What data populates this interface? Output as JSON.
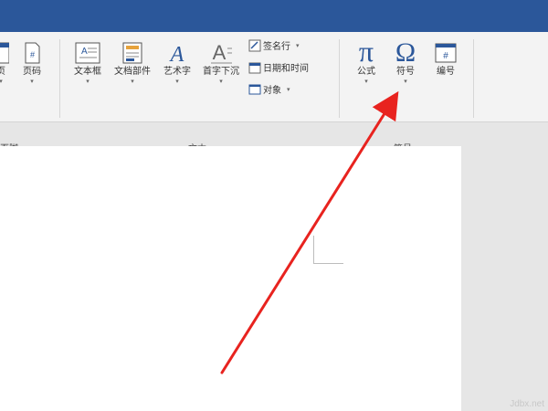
{
  "ribbon": {
    "groups": {
      "header_footer": {
        "label": "页脚",
        "buttons": {
          "partial": "页",
          "page_number": "页码"
        }
      },
      "text": {
        "label": "文本",
        "buttons": {
          "textbox": "文本框",
          "quick_parts": "文档部件",
          "wordart": "艺术字",
          "dropcap": "首字下沉",
          "signature_line": "签名行",
          "date_time": "日期和时间",
          "object": "对象"
        }
      },
      "symbols": {
        "label": "符号",
        "buttons": {
          "equation": "公式",
          "symbol": "符号",
          "number": "编号"
        }
      }
    },
    "glyphs": {
      "pi": "π",
      "omega": "Ω",
      "wordart_a": "A",
      "dropcap_a": "A",
      "hash": "#",
      "dropdown": "▾"
    }
  },
  "annotation": {
    "arrow_color": "#e8231f"
  },
  "watermark": "Jdbx.net",
  "colors": {
    "titlebar": "#2b579a",
    "ribbon": "#f3f3f3",
    "workspace": "#e6e6e6",
    "accent_blue": "#2b579a"
  }
}
